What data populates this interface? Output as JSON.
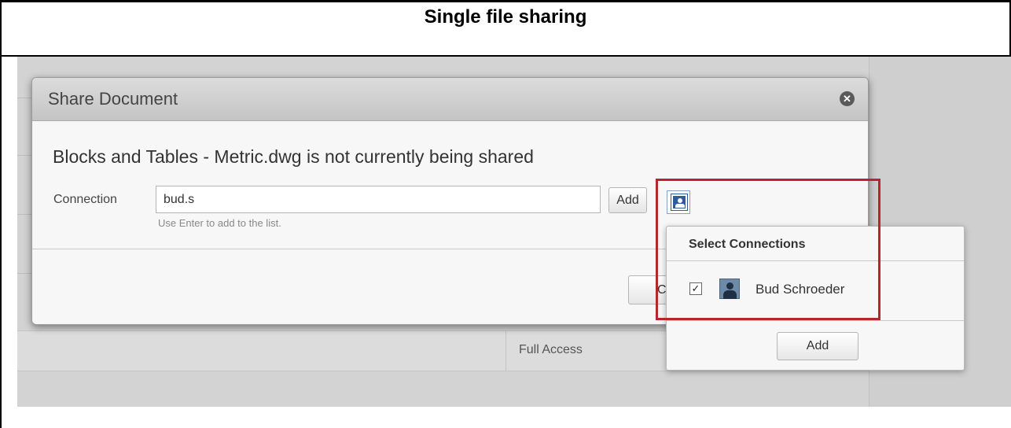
{
  "caption": "Single file sharing",
  "dialog": {
    "title": "Share Document",
    "close_icon": "close-circle-icon",
    "status_message": "Blocks and Tables - Metric.dwg is not currently being shared",
    "connection_label": "Connection",
    "connection_value": "bud.s",
    "hint": "Use Enter to add to the list.",
    "add_label": "Add",
    "contacts_icon": "contacts-icon",
    "cancel_label": "Cancel"
  },
  "background": {
    "access_level": "Full Access"
  },
  "popup": {
    "title": "Select Connections",
    "items": [
      {
        "name": "Bud Schroeder",
        "checked": true,
        "icon": "user-avatar-icon"
      }
    ],
    "add_label": "Add"
  },
  "colors": {
    "highlight": "#b5262e",
    "contacts_button": "#2f5d9a"
  }
}
